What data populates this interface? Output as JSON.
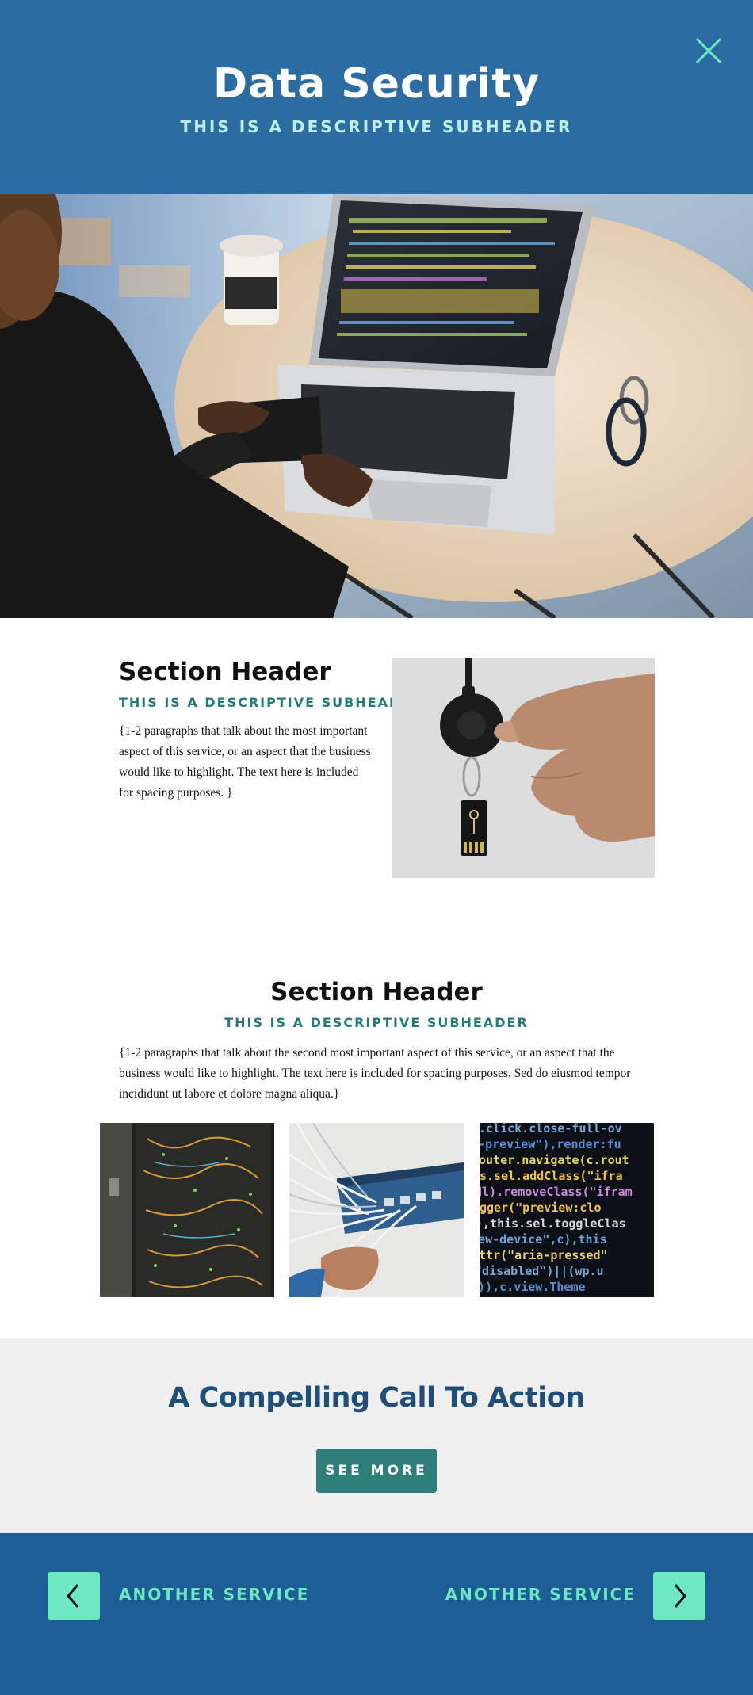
{
  "header": {
    "title": "Data Security",
    "subtitle": "THIS IS A DESCRIPTIVE SUBHEADER",
    "close_icon": "close-icon"
  },
  "colors": {
    "header_bg": "#2b6da3",
    "accent_mint": "#6ee8c1",
    "teal": "#237a7e",
    "cta_bg": "#efefef",
    "footer_bg": "#1d5e96"
  },
  "section1": {
    "title": "Section Header",
    "subtitle": "THIS IS A DESCRIPTIVE SUBHEADER",
    "body": "{1-2 paragraphs that talk about the most important aspect of this service, or an aspect that the business would like to highlight. The text here is included for spacing purposes. }"
  },
  "section2": {
    "title": "Section Header",
    "subtitle": "THIS IS A DESCRIPTIVE SUBHEADER",
    "body": "{1-2 paragraphs that talk about the second most important aspect of this service, or an aspect that the business would like to highlight. The text here is included for spacing purposes. Sed do eiusmod tempor incididunt ut labore et dolore magna aliqua.}"
  },
  "cta": {
    "title": "A Compelling Call To Action",
    "button_label": "SEE MORE"
  },
  "footer": {
    "prev_label": "ANOTHER SERVICE",
    "next_label": "ANOTHER SERVICE",
    "prev_icon": "chevron-left-icon",
    "next_icon": "chevron-right-icon"
  }
}
